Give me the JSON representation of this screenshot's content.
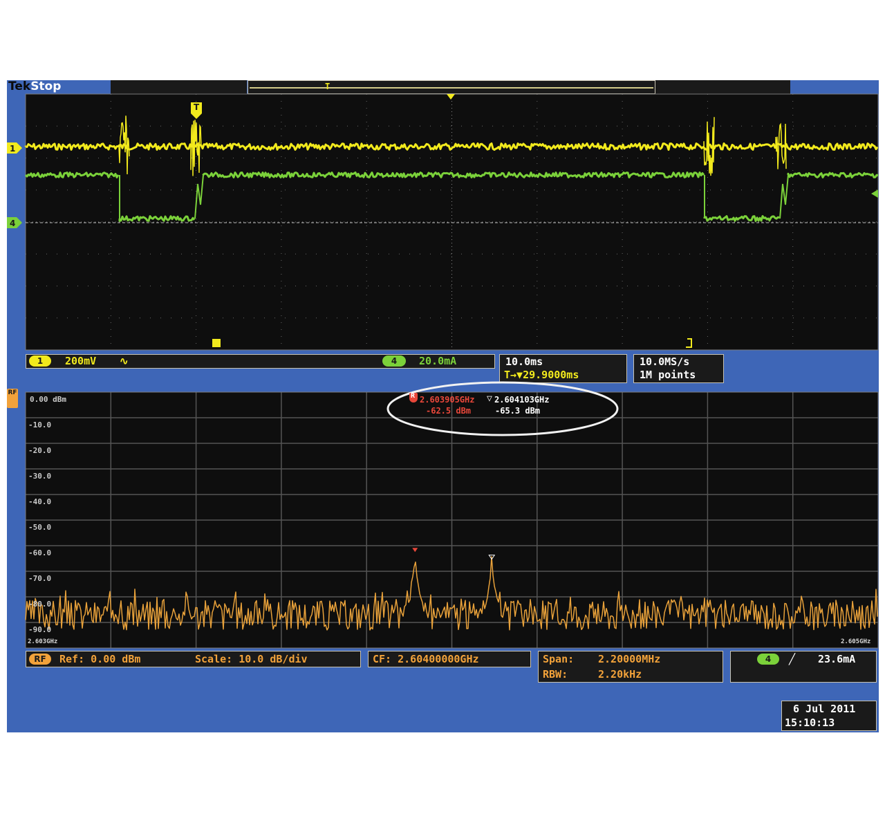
{
  "header": {
    "brand": "Tek",
    "status": "Stop",
    "trigger_pos_marker": "T"
  },
  "time_domain": {
    "ch1": {
      "badge": "1",
      "scale": "200mV",
      "coupling_symbol": "∿",
      "color": "#f2ea1d"
    },
    "ch4": {
      "badge": "4",
      "scale": "20.0mA",
      "color": "#7bd13a"
    },
    "trigger_marker": "T",
    "horizontal": {
      "scale": "10.0ms",
      "delay": "T→▼29.9000ms"
    },
    "acquisition": {
      "sample_rate": "10.0MS/s",
      "record_length": "1M points"
    }
  },
  "frequency_domain": {
    "rf_badge": "RF",
    "y_axis_labels": [
      "0.00 dBm",
      "-10.0",
      "-20.0",
      "-30.0",
      "-40.0",
      "-50.0",
      "-60.0",
      "-70.0",
      "-80.0",
      "-90.0"
    ],
    "x_start_label": "2.603GHz",
    "x_end_label": "2.605GHz",
    "markers": {
      "reference": {
        "symbol": "R",
        "frequency": "2.603905GHz",
        "amplitude": "-62.5 dBm"
      },
      "delta": {
        "symbol": "▽",
        "frequency": "2.604103GHz",
        "amplitude": "-65.3 dBm"
      }
    },
    "ref_level": "Ref: 0.00 dBm",
    "scale": "Scale: 10.0 dB/div",
    "center_freq": "CF:  2.60400000GHz",
    "span_label": "Span:",
    "span_value": "2.20000MHz",
    "rbw_label": "RBW:",
    "rbw_value": "2.20kHz",
    "trigger": {
      "badge": "4",
      "slope_symbol": "╱",
      "level": "23.6mA"
    }
  },
  "datetime": {
    "date": "6 Jul  2011",
    "time": "15:10:13"
  },
  "colors": {
    "screen": "#3e66b7",
    "graticule_bg": "#0e0e0e",
    "spectrum": "#e8a13a",
    "marker": "#e8473a",
    "readout": "#f2ea1d"
  }
}
